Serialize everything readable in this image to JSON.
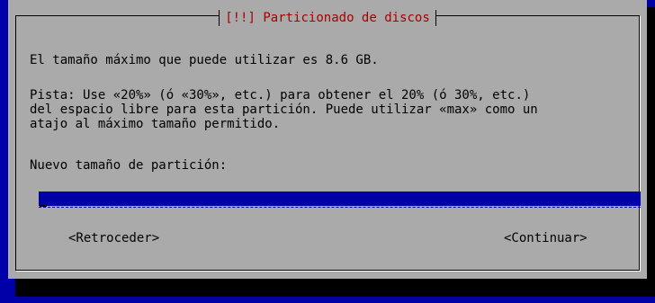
{
  "dialog": {
    "title": "[!!] Particionado de discos",
    "line_max_size": "El tamaño máximo que puede utilizar es 8.6 GB.",
    "hint": "Pista: Use «20%» (ó «30%», etc.) para obtener el 20% (ó 30%, etc.)\ndel espacio libre para esta partición. Puede utilizar «max» como un\natajo al máximo tamaño permitido.",
    "field_label": "Nuevo tamaño de partición:",
    "field_value": "",
    "buttons": {
      "back": "<Retroceder>",
      "continue": "<Continuar>"
    }
  },
  "colors": {
    "background": "#0000a8",
    "dialog": "#aaaaaa",
    "title": "#a80000",
    "input": "#0000a8"
  }
}
